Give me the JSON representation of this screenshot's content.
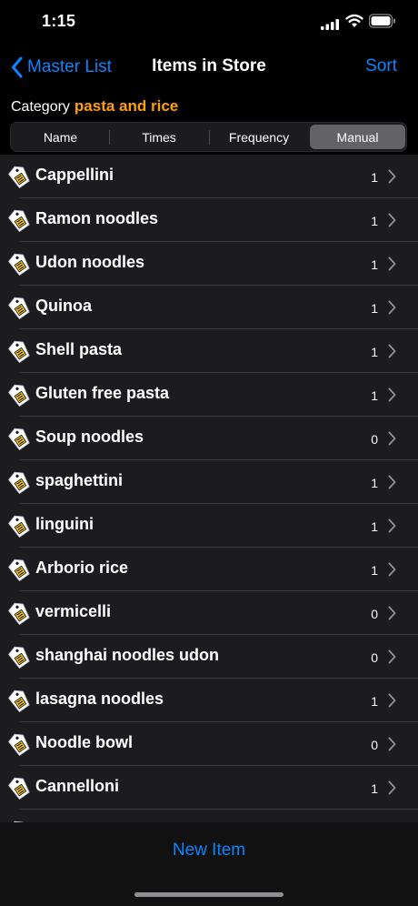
{
  "status": {
    "time": "1:15"
  },
  "nav": {
    "back_label": "Master List",
    "title": "Items in Store",
    "sort_label": "Sort"
  },
  "category": {
    "label": "Category",
    "value": "pasta and rice"
  },
  "segments": [
    "Name",
    "Times",
    "Frequency",
    "Manual"
  ],
  "selected_segment": "Manual",
  "items": [
    {
      "name": "Cappellini",
      "count": "1"
    },
    {
      "name": "Ramon noodles",
      "count": "1"
    },
    {
      "name": "Udon noodles",
      "count": "1"
    },
    {
      "name": "Quinoa",
      "count": "1"
    },
    {
      "name": "Shell pasta",
      "count": "1"
    },
    {
      "name": "Gluten free pasta",
      "count": "1"
    },
    {
      "name": "Soup noodles",
      "count": "0"
    },
    {
      "name": "spaghettini",
      "count": "1"
    },
    {
      "name": "linguini",
      "count": "1"
    },
    {
      "name": "Arborio rice",
      "count": "1"
    },
    {
      "name": "vermicelli",
      "count": "0"
    },
    {
      "name": "shanghai noodles udon",
      "count": "0"
    },
    {
      "name": "lasagna noodles",
      "count": "1"
    },
    {
      "name": "Noodle bowl",
      "count": "0"
    },
    {
      "name": "Cannelloni",
      "count": "1"
    },
    {
      "name": "",
      "count": ""
    }
  ],
  "footer": {
    "new_item_label": "New Item"
  },
  "colors": {
    "accent": "#0a84ff",
    "category": "#ff9f0a"
  }
}
